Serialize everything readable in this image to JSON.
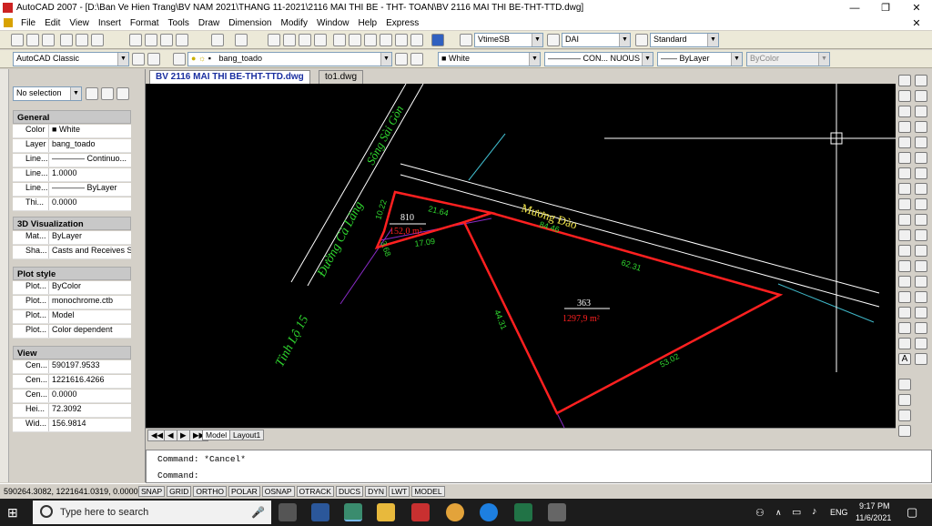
{
  "window": {
    "title": "AutoCAD 2007 - [D:\\Ban Ve Hien Trang\\BV NAM 2021\\THANG 11-2021\\2116 MAI THI BE - THT- TOAN\\BV 2116 MAI THI BE-THT-TTD.dwg]"
  },
  "menu": [
    "File",
    "Edit",
    "View",
    "Insert",
    "Format",
    "Tools",
    "Draw",
    "Dimension",
    "Modify",
    "Window",
    "Help",
    "Express"
  ],
  "toolbar": {
    "text_style": "VtimeSB",
    "dim_style": "DAI",
    "table_style": "Standard",
    "workspace": "AutoCAD Classic",
    "layer": "bang_toado",
    "color": "White",
    "linetype": "CON... NUOUS",
    "lineweight": "ByLayer",
    "plotstyle": "ByColor"
  },
  "properties": {
    "selection": "No selection",
    "general_title": "General",
    "general": [
      {
        "k": "Color",
        "v": "White"
      },
      {
        "k": "Layer",
        "v": "bang_toado"
      },
      {
        "k": "Line...",
        "v": "———— Continuo..."
      },
      {
        "k": "Line...",
        "v": "1.0000"
      },
      {
        "k": "Line...",
        "v": "———— ByLayer"
      },
      {
        "k": "Thi...",
        "v": "0.0000"
      }
    ],
    "viz_title": "3D Visualization",
    "viz": [
      {
        "k": "Mat...",
        "v": "ByLayer"
      },
      {
        "k": "Sha...",
        "v": "Casts and Receives S..."
      }
    ],
    "plot_title": "Plot style",
    "plot": [
      {
        "k": "Plot...",
        "v": "ByColor"
      },
      {
        "k": "Plot...",
        "v": "monochrome.ctb"
      },
      {
        "k": "Plot...",
        "v": "Model"
      },
      {
        "k": "Plot...",
        "v": "Color dependent"
      }
    ],
    "view_title": "View",
    "view": [
      {
        "k": "Cen...",
        "v": "590197.9533"
      },
      {
        "k": "Cen...",
        "v": "1221616.4266"
      },
      {
        "k": "Cen...",
        "v": "0.0000"
      },
      {
        "k": "Hei...",
        "v": "72.3092"
      },
      {
        "k": "Wid...",
        "v": "156.9814"
      }
    ]
  },
  "tabs": [
    "BV 2116 MAI THI BE-THT-TTD.dwg",
    "to1.dwg"
  ],
  "drawing": {
    "road1": "Tỉnh Lộ 15",
    "road2": "Đường Cá Lăng",
    "river": "Sông Sài Gòn",
    "canal": "Mương Đào",
    "lot1_no": "810",
    "lot1_area": "152,0 m²",
    "lot2_no": "363",
    "lot2_area": "1297,9 m²",
    "d1": "10.22",
    "d2": "21.64",
    "d3": "3.68",
    "d4": "17.09",
    "d5": "84.46",
    "d6": "62.31",
    "d7": "44.31",
    "d8": "53.02"
  },
  "layout": {
    "model": "Model",
    "layout1": "Layout1"
  },
  "command": {
    "line1": "Command: *Cancel*",
    "line2": "Command:"
  },
  "status": {
    "coords": "590264.3082, 1221641.0319, 0.0000",
    "buttons": [
      "SNAP",
      "GRID",
      "ORTHO",
      "POLAR",
      "OSNAP",
      "OTRACK",
      "DUCS",
      "DYN",
      "LWT",
      "MODEL"
    ]
  },
  "taskbar": {
    "search": "Type here to search",
    "lang": "ENG",
    "time": "9:17 PM",
    "date": "11/6/2021"
  },
  "colors": {
    "green": "#2fd72f",
    "red": "#ff2020",
    "cyan": "#3fb7c8"
  }
}
